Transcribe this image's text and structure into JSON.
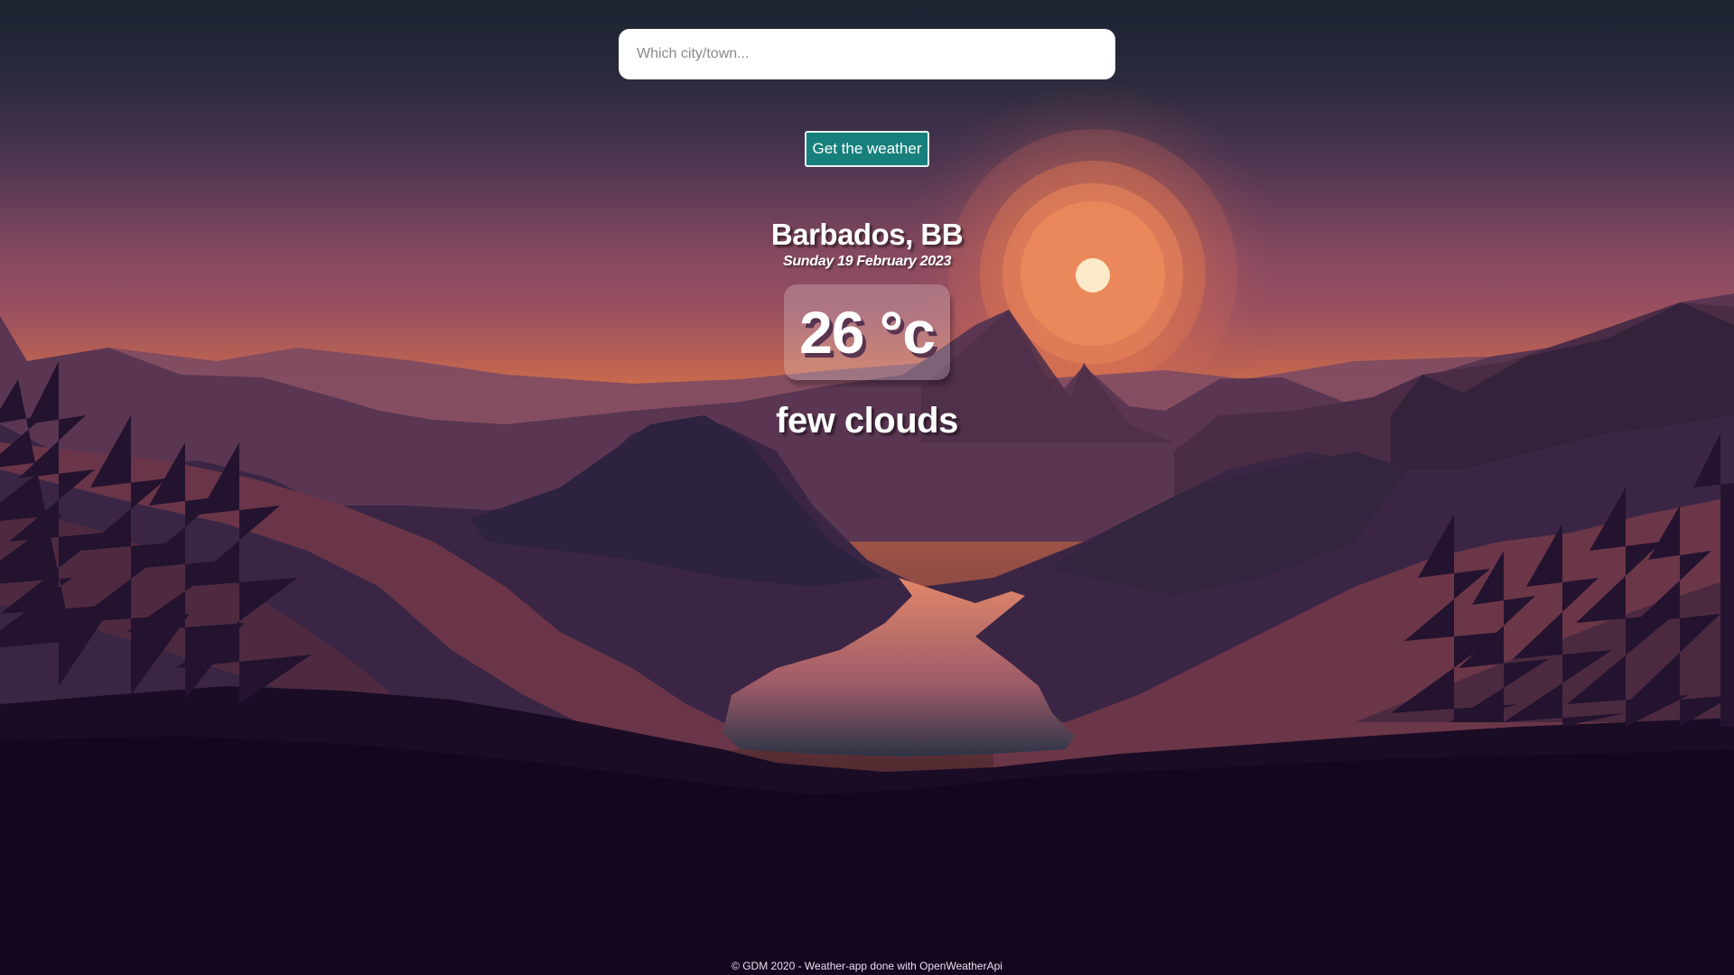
{
  "search": {
    "placeholder": "Which city/town..."
  },
  "button": {
    "label": "Get the weather"
  },
  "weather": {
    "location": "Barbados, BB",
    "date": "Sunday 19 February 2023",
    "temperature": "26 °c",
    "description": "few clouds"
  },
  "footer": {
    "text": "© GDM 2020 - Weather-app done with OpenWeatherApi"
  },
  "colors": {
    "button_bg": "#17807d",
    "sky_top": "#1b2431",
    "sky_mid": "#8a4b63",
    "horizon": "#d8734a",
    "ground": "#120720"
  }
}
